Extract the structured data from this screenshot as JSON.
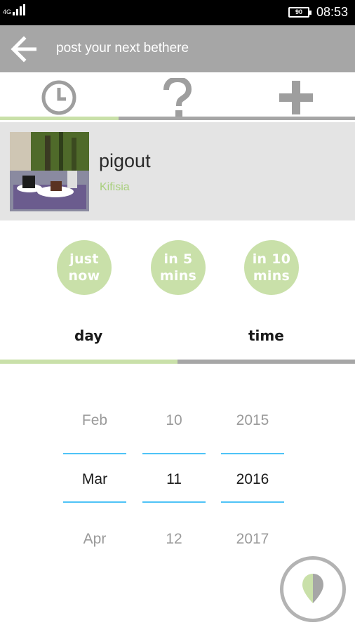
{
  "status_bar": {
    "network": "4G",
    "battery": "90",
    "time": "08:53"
  },
  "app_bar": {
    "title": "post your next bethere",
    "back_icon": "arrow-left-icon"
  },
  "tabs": [
    {
      "icon": "clock-icon",
      "active": true
    },
    {
      "icon": "question-icon",
      "active": false
    },
    {
      "icon": "plus-icon",
      "active": false
    }
  ],
  "place": {
    "name": "pigout",
    "location": "Kifisia"
  },
  "quick_times": [
    {
      "line1": "just",
      "line2": "now"
    },
    {
      "line1": "in 5",
      "line2": "mins"
    },
    {
      "line1": "in 10",
      "line2": "mins"
    }
  ],
  "segments": {
    "day": "day",
    "time": "time",
    "active": "day"
  },
  "date_picker": {
    "month": {
      "prev": "Feb",
      "current": "Mar",
      "next": "Apr"
    },
    "day": {
      "prev": "10",
      "current": "11",
      "next": "12"
    },
    "year": {
      "prev": "2015",
      "current": "2016",
      "next": "2017"
    }
  },
  "colors": {
    "accent_green": "#c9e0a9",
    "location_green": "#a8cf7c",
    "app_bar": "#a6a6a6",
    "picker_line": "#4fc3f7",
    "tab_icon": "#9e9e9e"
  },
  "fab": {
    "icon": "location-pin-icon"
  }
}
